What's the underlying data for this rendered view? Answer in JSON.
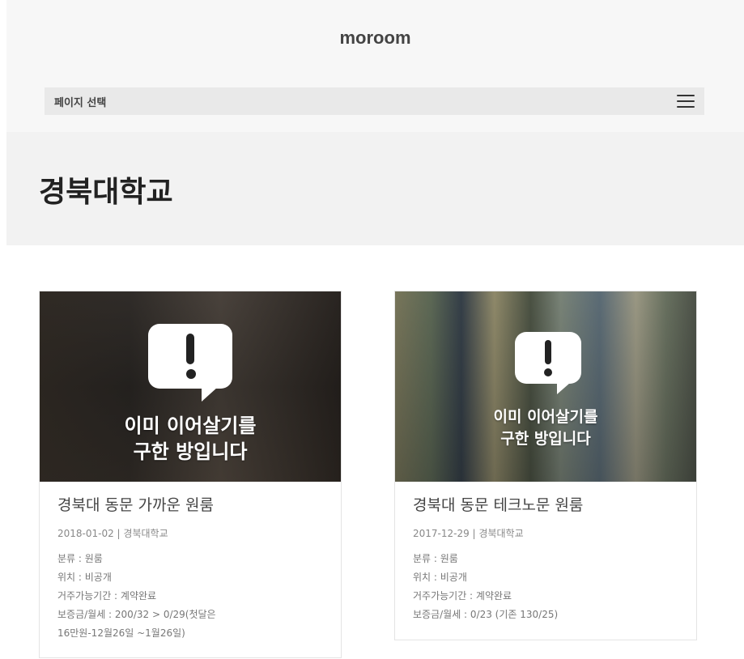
{
  "brand": "moroom",
  "nav": {
    "label": "페이지 선택",
    "menu_icon": "hamburger-menu-icon"
  },
  "hero": {
    "title": "경북대학교"
  },
  "listings": [
    {
      "image_overlay_line1": "이미 이어살기를",
      "image_overlay_line2": "구한 방입니다",
      "title": "경북대 동문 가까운 원룸",
      "meta": "2018-01-02 | 경북대학교",
      "category": "분류 : 원룸",
      "location": "위치 : 비공개",
      "period": "거주가능기간 : 계약완료",
      "deposit": "보증금/월세 : 200/32 > 0/29(첫달은",
      "deposit_cont": "16만원-12월26일 ~1월26일)"
    },
    {
      "image_overlay_line1": "이미 이어살기를",
      "image_overlay_line2": "구한 방입니다",
      "title": "경북대 동문 테크노문 원룸",
      "meta": "2017-12-29 | 경북대학교",
      "category": "분류 : 원룸",
      "location": "위치 : 비공개",
      "period": "거주가능기간 : 계약완료",
      "deposit": "보증금/월세 : 0/23 (기존 130/25)"
    }
  ]
}
